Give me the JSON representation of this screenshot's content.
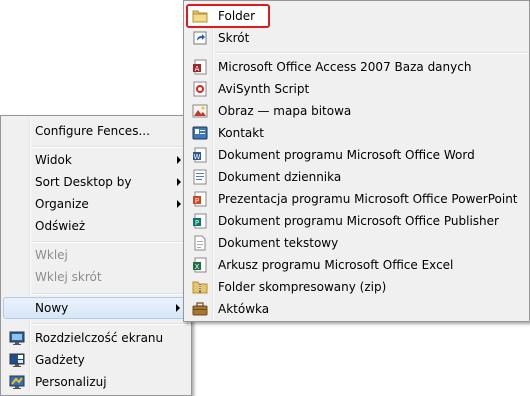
{
  "context_menu": {
    "configure_fences": "Configure Fences...",
    "view": "Widok",
    "sort_by": "Sort Desktop by",
    "organize": "Organize",
    "refresh": "Odśwież",
    "paste": "Wklej",
    "paste_shortcut": "Wklej skrót",
    "new": "Nowy",
    "screen_resolution": "Rozdzielczość ekranu",
    "gadgets": "Gadżety",
    "personalize": "Personalizuj"
  },
  "new_submenu": {
    "folder": "Folder",
    "shortcut": "Skrót",
    "access_db": "Microsoft Office Access 2007 Baza danych",
    "avisynth": "AviSynth Script",
    "bitmap": "Obraz — mapa bitowa",
    "contact": "Kontakt",
    "word_doc": "Dokument programu Microsoft Office Word",
    "journal": "Dokument dziennika",
    "powerpoint": "Prezentacja programu Microsoft Office PowerPoint",
    "publisher": "Dokument programu Microsoft Office Publisher",
    "text_doc": "Dokument tekstowy",
    "excel": "Arkusz programu Microsoft Office Excel",
    "zip": "Folder skompresowany (zip)",
    "briefcase": "Aktówka"
  },
  "colors": {
    "highlight_border": "#e11b1b",
    "hover_bg": "#d6e7f8"
  }
}
